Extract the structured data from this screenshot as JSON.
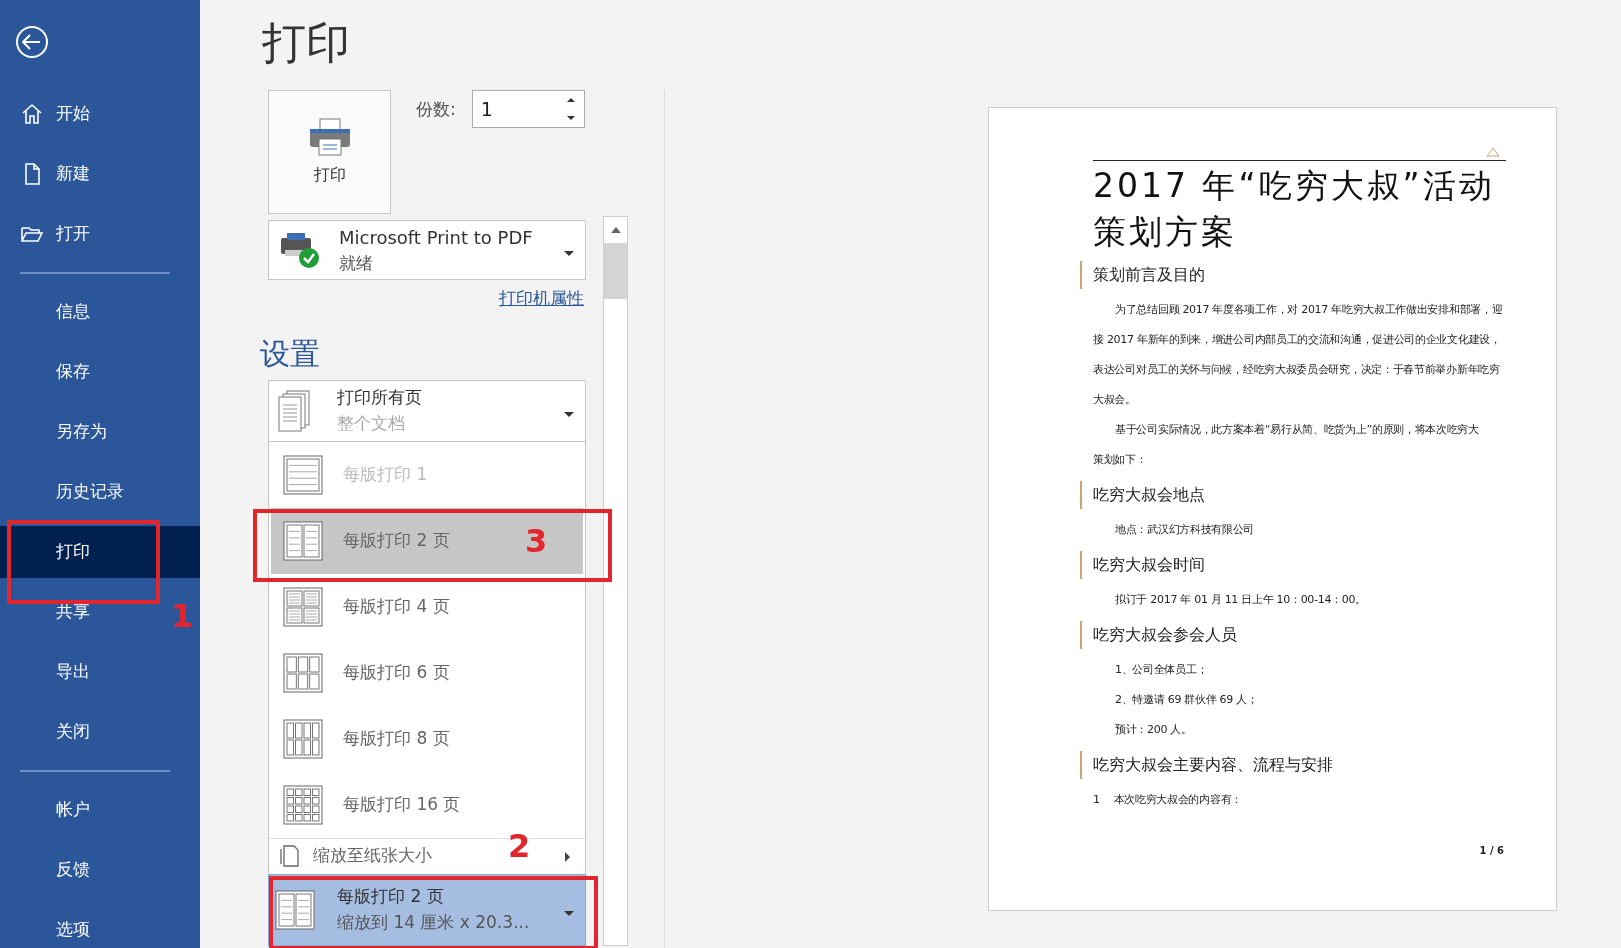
{
  "sidebar": {
    "groups": [
      [
        {
          "kind": "back",
          "selected": false
        },
        {
          "kind": "home",
          "label": "开始",
          "selected": false
        },
        {
          "kind": "new",
          "label": "新建",
          "selected": false
        },
        {
          "kind": "open",
          "label": "打开",
          "selected": false
        }
      ],
      [
        {
          "kind": "text",
          "label": "信息",
          "selected": false
        },
        {
          "kind": "text",
          "label": "保存",
          "selected": false
        },
        {
          "kind": "text",
          "label": "另存为",
          "selected": false
        },
        {
          "kind": "text",
          "label": "历史记录",
          "selected": false
        },
        {
          "kind": "text",
          "label": "打印",
          "selected": true
        },
        {
          "kind": "text",
          "label": "共享",
          "selected": false
        },
        {
          "kind": "text",
          "label": "导出",
          "selected": false
        },
        {
          "kind": "text",
          "label": "关闭",
          "selected": false
        }
      ],
      [
        {
          "kind": "text",
          "label": "帐户",
          "selected": false
        },
        {
          "kind": "text",
          "label": "反馈",
          "selected": false
        },
        {
          "kind": "text",
          "label": "选项",
          "selected": false
        }
      ]
    ]
  },
  "title": "打印",
  "print_button": {
    "label": "打印"
  },
  "copies": {
    "label": "份数:",
    "value": "1"
  },
  "printer": {
    "name": "Microsoft Print to PDF",
    "status": "就绪"
  },
  "printer_properties_link": "打印机属性",
  "settings_heading": "设置",
  "pages_dropdown": {
    "title": "打印所有页",
    "subtitle": "整个文档"
  },
  "layout_menu": {
    "items": [
      {
        "kind": "one",
        "label": "每版打印 1",
        "selected": false
      },
      {
        "kind": "two",
        "label": "每版打印 2 页",
        "selected": true
      },
      {
        "kind": "four",
        "label": "每版打印 4 页",
        "selected": false
      },
      {
        "kind": "six",
        "label": "每版打印 6 页",
        "selected": false
      },
      {
        "kind": "eight",
        "label": "每版打印 8 页",
        "selected": false
      },
      {
        "kind": "sixteen",
        "label": "每版打印 16 页",
        "selected": false
      }
    ],
    "scale_item": {
      "label": "缩放至纸张大小"
    }
  },
  "layout_dropdown": {
    "kind": "two",
    "title": "每版打印 2 页",
    "subtitle": "缩放到 14 厘米 x 20.3..."
  },
  "preview": {
    "title_lines": [
      "2017 年“吃穷大叔”活动",
      "策划方案"
    ],
    "blocks": [
      {
        "kind": "heading",
        "text": "策划前言及目的"
      },
      {
        "kind": "para",
        "text": "为了总结回顾 2017 年度各项工作，对 2017 年吃穷大叔工作做出安排和部署，迎接 2017 年新年的到来，增进公司内部员工的交流和沟通，促进公司的企业文化建设，表达公司对员工的关怀与问候，经吃穷大叔委员会研究，决定：于春节前举办新年吃穷大叔会。"
      },
      {
        "kind": "para",
        "text": "基于公司实际情况，此方案本着“易行从简、吃货为上”的原则，将本次吃穷大"
      },
      {
        "kind": "line",
        "text": "策划如下："
      },
      {
        "kind": "heading",
        "text": "吃穷大叔会地点"
      },
      {
        "kind": "para",
        "text": "地点：武汉幻方科技有限公司"
      },
      {
        "kind": "heading",
        "text": "吃穷大叔会时间"
      },
      {
        "kind": "para",
        "text": "拟订于 2017 年 01 月 11 日上午 10：00-14：00。"
      },
      {
        "kind": "heading",
        "text": "吃穷大叔会参会人员"
      },
      {
        "kind": "para",
        "text": "1、公司全体员工；"
      },
      {
        "kind": "para",
        "text": "2、特邀请 69 群伙伴 69 人；"
      },
      {
        "kind": "para",
        "text": "预计：200 人。"
      },
      {
        "kind": "heading",
        "text": "吃穷大叔会主要内容、流程与安排"
      },
      {
        "kind": "line",
        "text": "1　 本次吃穷大叔会的内容有："
      }
    ],
    "page_number": "1 / 6"
  },
  "annotations": [
    {
      "label": "1"
    },
    {
      "label": "2"
    },
    {
      "label": "3"
    }
  ]
}
